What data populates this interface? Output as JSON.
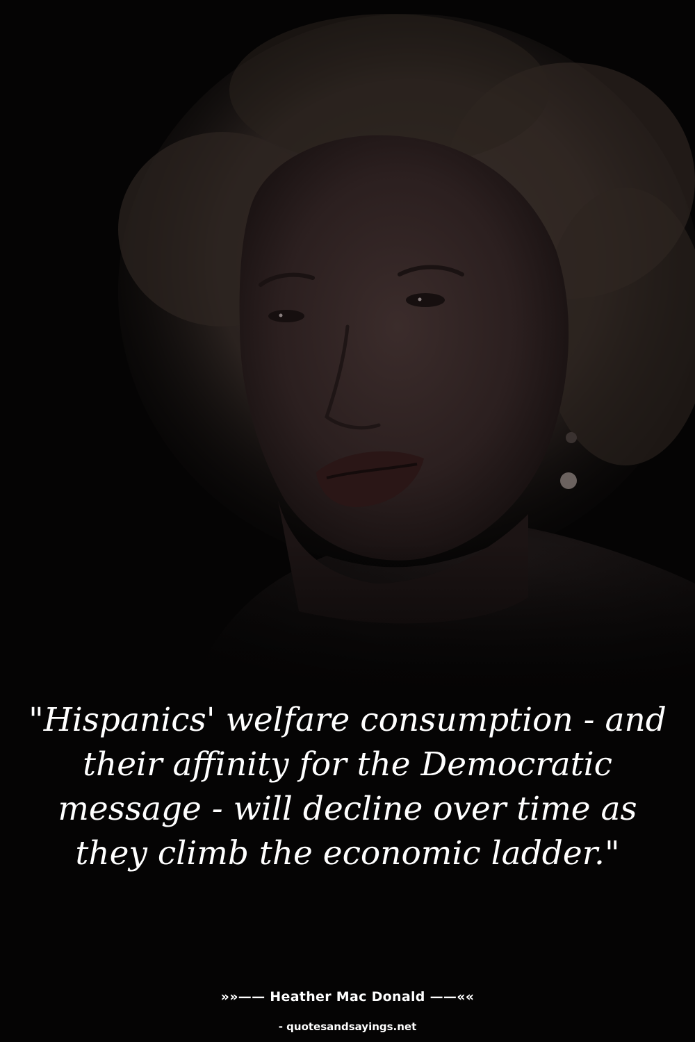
{
  "image": {
    "subject": "portrait-photo",
    "background_color": "#050404",
    "text_color": "#ffffff"
  },
  "quote": {
    "text": "\"Hispanics' welfare consumption - and their affinity for the Democratic message - will decline over time as they climb the economic ladder.\""
  },
  "attribution": {
    "author_line": "»»—— Heather Mac Donald ——««",
    "source": "- quotesandsayings.net"
  }
}
